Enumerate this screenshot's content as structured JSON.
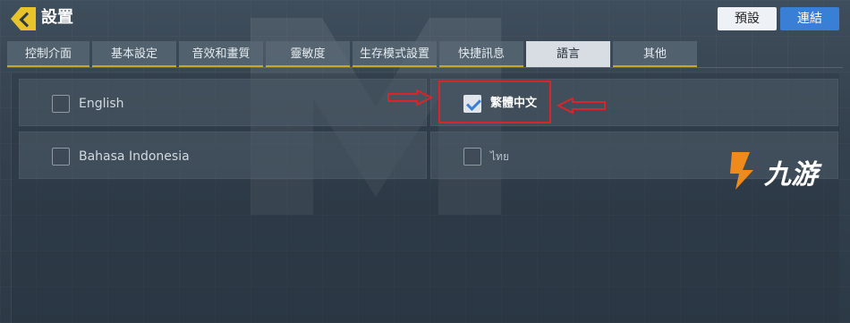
{
  "header": {
    "title": "設置",
    "preset_label": "預設",
    "connect_label": "連結"
  },
  "tabs": [
    {
      "label": "控制介面",
      "active": false
    },
    {
      "label": "基本設定",
      "active": false
    },
    {
      "label": "音效和畫質",
      "active": false
    },
    {
      "label": "靈敏度",
      "active": false
    },
    {
      "label": "生存模式設置",
      "active": false
    },
    {
      "label": "快捷訊息",
      "active": false
    },
    {
      "label": "語言",
      "active": true
    },
    {
      "label": "其他",
      "active": false
    }
  ],
  "languages": [
    {
      "label": "English",
      "checked": false
    },
    {
      "label": "繁體中文",
      "checked": true
    },
    {
      "label": "Bahasa Indonesia",
      "checked": false
    },
    {
      "label": "ไทย",
      "checked": false
    }
  ],
  "watermark": {
    "text": "九游"
  },
  "colors": {
    "accent_yellow": "#e8c42a",
    "connect_blue": "#3a7fd6",
    "annotation_red": "#d9252a"
  }
}
